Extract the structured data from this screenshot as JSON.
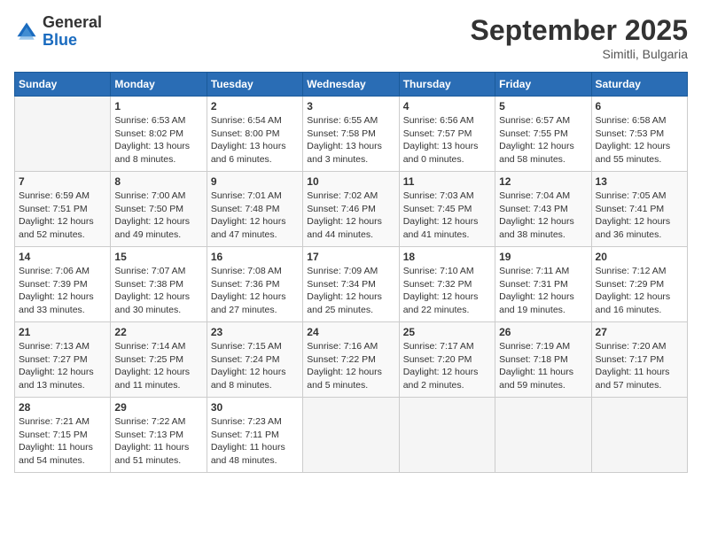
{
  "header": {
    "logo_general": "General",
    "logo_blue": "Blue",
    "month_title": "September 2025",
    "location": "Simitli, Bulgaria"
  },
  "days_of_week": [
    "Sunday",
    "Monday",
    "Tuesday",
    "Wednesday",
    "Thursday",
    "Friday",
    "Saturday"
  ],
  "weeks": [
    [
      {
        "day": "",
        "info": ""
      },
      {
        "day": "1",
        "info": "Sunrise: 6:53 AM\nSunset: 8:02 PM\nDaylight: 13 hours\nand 8 minutes."
      },
      {
        "day": "2",
        "info": "Sunrise: 6:54 AM\nSunset: 8:00 PM\nDaylight: 13 hours\nand 6 minutes."
      },
      {
        "day": "3",
        "info": "Sunrise: 6:55 AM\nSunset: 7:58 PM\nDaylight: 13 hours\nand 3 minutes."
      },
      {
        "day": "4",
        "info": "Sunrise: 6:56 AM\nSunset: 7:57 PM\nDaylight: 13 hours\nand 0 minutes."
      },
      {
        "day": "5",
        "info": "Sunrise: 6:57 AM\nSunset: 7:55 PM\nDaylight: 12 hours\nand 58 minutes."
      },
      {
        "day": "6",
        "info": "Sunrise: 6:58 AM\nSunset: 7:53 PM\nDaylight: 12 hours\nand 55 minutes."
      }
    ],
    [
      {
        "day": "7",
        "info": "Sunrise: 6:59 AM\nSunset: 7:51 PM\nDaylight: 12 hours\nand 52 minutes."
      },
      {
        "day": "8",
        "info": "Sunrise: 7:00 AM\nSunset: 7:50 PM\nDaylight: 12 hours\nand 49 minutes."
      },
      {
        "day": "9",
        "info": "Sunrise: 7:01 AM\nSunset: 7:48 PM\nDaylight: 12 hours\nand 47 minutes."
      },
      {
        "day": "10",
        "info": "Sunrise: 7:02 AM\nSunset: 7:46 PM\nDaylight: 12 hours\nand 44 minutes."
      },
      {
        "day": "11",
        "info": "Sunrise: 7:03 AM\nSunset: 7:45 PM\nDaylight: 12 hours\nand 41 minutes."
      },
      {
        "day": "12",
        "info": "Sunrise: 7:04 AM\nSunset: 7:43 PM\nDaylight: 12 hours\nand 38 minutes."
      },
      {
        "day": "13",
        "info": "Sunrise: 7:05 AM\nSunset: 7:41 PM\nDaylight: 12 hours\nand 36 minutes."
      }
    ],
    [
      {
        "day": "14",
        "info": "Sunrise: 7:06 AM\nSunset: 7:39 PM\nDaylight: 12 hours\nand 33 minutes."
      },
      {
        "day": "15",
        "info": "Sunrise: 7:07 AM\nSunset: 7:38 PM\nDaylight: 12 hours\nand 30 minutes."
      },
      {
        "day": "16",
        "info": "Sunrise: 7:08 AM\nSunset: 7:36 PM\nDaylight: 12 hours\nand 27 minutes."
      },
      {
        "day": "17",
        "info": "Sunrise: 7:09 AM\nSunset: 7:34 PM\nDaylight: 12 hours\nand 25 minutes."
      },
      {
        "day": "18",
        "info": "Sunrise: 7:10 AM\nSunset: 7:32 PM\nDaylight: 12 hours\nand 22 minutes."
      },
      {
        "day": "19",
        "info": "Sunrise: 7:11 AM\nSunset: 7:31 PM\nDaylight: 12 hours\nand 19 minutes."
      },
      {
        "day": "20",
        "info": "Sunrise: 7:12 AM\nSunset: 7:29 PM\nDaylight: 12 hours\nand 16 minutes."
      }
    ],
    [
      {
        "day": "21",
        "info": "Sunrise: 7:13 AM\nSunset: 7:27 PM\nDaylight: 12 hours\nand 13 minutes."
      },
      {
        "day": "22",
        "info": "Sunrise: 7:14 AM\nSunset: 7:25 PM\nDaylight: 12 hours\nand 11 minutes."
      },
      {
        "day": "23",
        "info": "Sunrise: 7:15 AM\nSunset: 7:24 PM\nDaylight: 12 hours\nand 8 minutes."
      },
      {
        "day": "24",
        "info": "Sunrise: 7:16 AM\nSunset: 7:22 PM\nDaylight: 12 hours\nand 5 minutes."
      },
      {
        "day": "25",
        "info": "Sunrise: 7:17 AM\nSunset: 7:20 PM\nDaylight: 12 hours\nand 2 minutes."
      },
      {
        "day": "26",
        "info": "Sunrise: 7:19 AM\nSunset: 7:18 PM\nDaylight: 11 hours\nand 59 minutes."
      },
      {
        "day": "27",
        "info": "Sunrise: 7:20 AM\nSunset: 7:17 PM\nDaylight: 11 hours\nand 57 minutes."
      }
    ],
    [
      {
        "day": "28",
        "info": "Sunrise: 7:21 AM\nSunset: 7:15 PM\nDaylight: 11 hours\nand 54 minutes."
      },
      {
        "day": "29",
        "info": "Sunrise: 7:22 AM\nSunset: 7:13 PM\nDaylight: 11 hours\nand 51 minutes."
      },
      {
        "day": "30",
        "info": "Sunrise: 7:23 AM\nSunset: 7:11 PM\nDaylight: 11 hours\nand 48 minutes."
      },
      {
        "day": "",
        "info": ""
      },
      {
        "day": "",
        "info": ""
      },
      {
        "day": "",
        "info": ""
      },
      {
        "day": "",
        "info": ""
      }
    ]
  ]
}
